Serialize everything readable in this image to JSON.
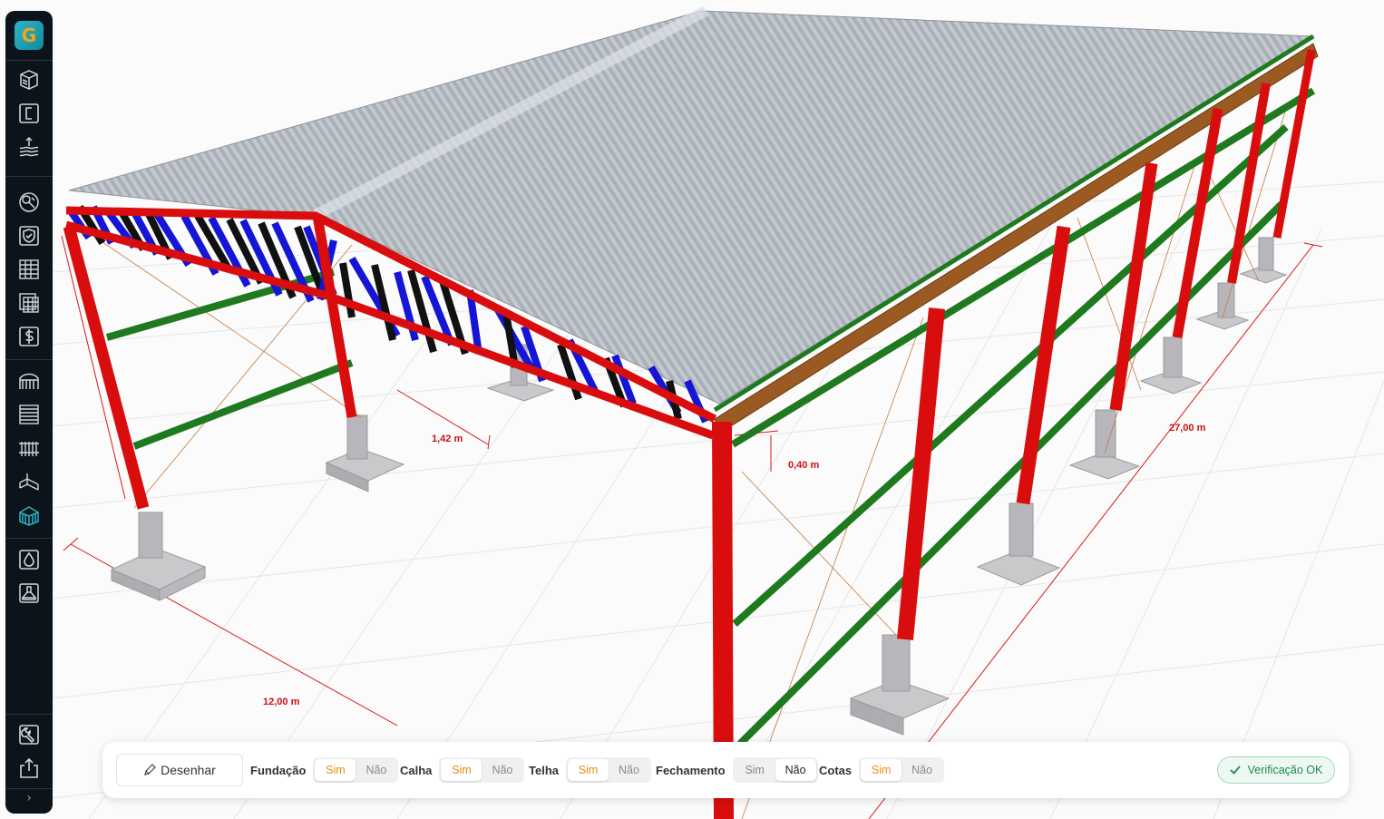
{
  "sidebar": {
    "logo_letter": "G",
    "tools": [
      {
        "name": "box-3d-icon"
      },
      {
        "name": "profile-c-icon"
      },
      {
        "name": "wind-load-icon"
      },
      {
        "name": "analysis-icon"
      },
      {
        "name": "shield-check-icon"
      },
      {
        "name": "table-icon"
      },
      {
        "name": "tables-icon"
      },
      {
        "name": "dollar-icon"
      },
      {
        "name": "roof-arch-icon"
      },
      {
        "name": "wall-panel-icon"
      },
      {
        "name": "fence-icon"
      },
      {
        "name": "profiles-icon"
      },
      {
        "name": "building-3d-icon"
      },
      {
        "name": "drop-icon"
      },
      {
        "name": "foundation-icon"
      },
      {
        "name": "wrench-icon"
      },
      {
        "name": "export-icon"
      }
    ],
    "expand_label": "›"
  },
  "dimensions": {
    "width": "12,00 m",
    "length": "27,00 m",
    "truss_height": "1,42 m",
    "eave_offset": "0,40 m"
  },
  "toolbar": {
    "draw_label": "Desenhar",
    "groups": [
      {
        "label": "Fundação",
        "yes": "Sim",
        "no": "Não",
        "selected": "yes"
      },
      {
        "label": "Calha",
        "yes": "Sim",
        "no": "Não",
        "selected": "yes"
      },
      {
        "label": "Telha",
        "yes": "Sim",
        "no": "Não",
        "selected": "yes"
      },
      {
        "label": "Fechamento",
        "yes": "Sim",
        "no": "Não",
        "selected": "no"
      },
      {
        "label": "Cotas",
        "yes": "Sim",
        "no": "Não",
        "selected": "yes"
      }
    ],
    "verify_label": "Verificação OK"
  },
  "colors": {
    "columns": "#d90d0d",
    "bracing": "#1515d6",
    "purlins": "#1f7a1f",
    "gutter": "#9a5a22",
    "roof": "#b9c0c7",
    "accent": "#f08a17",
    "ok": "#1c8a4c"
  }
}
